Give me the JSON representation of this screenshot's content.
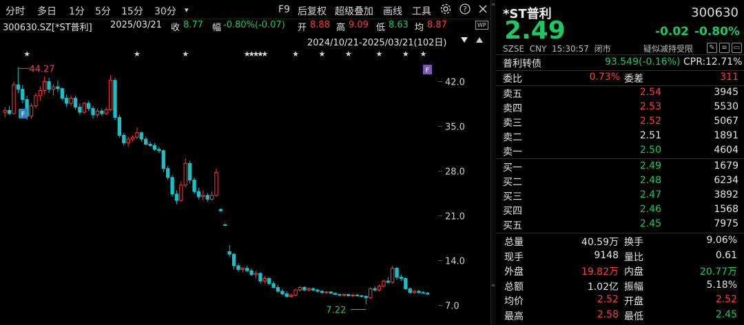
{
  "toolbar": {
    "items": [
      "分时",
      "多日",
      "1分",
      "5分",
      "15分",
      "30分",
      "▾",
      "F9",
      "后复权",
      "超级叠加",
      "画线",
      "工具"
    ],
    "gear_icon": "gear-icon",
    "help_icon": "question-icon",
    "close_icon": "close-icon"
  },
  "infobar": {
    "code": "300630.SZ[*ST普利]",
    "date": "2025/03/21",
    "close_label": "收",
    "close_value": "8.77",
    "change_label": "幅",
    "change_value": "-0.80%(-0.07)",
    "open_label": "开",
    "open_value": "8.88",
    "high_label": "高",
    "high_value": "9.09",
    "low_label": "低",
    "low_value": "8.63",
    "avg_label": "均",
    "avg_value": "8.87",
    "wp_icon": "WP"
  },
  "range": {
    "text": "2024/10/21-2025/03/21(102日)",
    "dropdown_icon": "triangle-down-icon"
  },
  "chart_data": {
    "type": "candlestick",
    "title": "",
    "xlabel": "",
    "ylabel": "",
    "ylim": [
      5.0,
      45.5
    ],
    "yticks": [
      "42.0",
      "35.0",
      "28.0",
      "21.0",
      "14.0",
      "7.0"
    ],
    "ytick_values": [
      42,
      35,
      28,
      21,
      14,
      7
    ],
    "max_label": "44.27",
    "min_label": "7.22",
    "f_markers": [
      "F",
      "F"
    ],
    "colors": {
      "up": "#ff3b3b",
      "down": "#18c0c8",
      "axis_text": "#cfcfcf",
      "grid": "#1f1f1f",
      "star": "#d8d8d8"
    },
    "candles": [
      [
        37.2,
        38.0,
        36.4,
        37.5
      ],
      [
        37.5,
        38.2,
        36.8,
        37.0
      ],
      [
        37.0,
        42.0,
        36.9,
        41.5
      ],
      [
        41.5,
        44.27,
        40.2,
        40.8
      ],
      [
        40.8,
        41.5,
        38.6,
        39.2
      ],
      [
        39.2,
        39.8,
        36.0,
        36.6
      ],
      [
        36.6,
        38.6,
        36.2,
        38.2
      ],
      [
        38.2,
        40.2,
        37.8,
        39.8
      ],
      [
        39.8,
        41.2,
        39.0,
        40.6
      ],
      [
        40.6,
        42.8,
        40.0,
        42.0
      ],
      [
        42.0,
        42.6,
        40.2,
        40.8
      ],
      [
        40.8,
        41.6,
        39.8,
        41.2
      ],
      [
        41.2,
        42.2,
        40.4,
        40.9
      ],
      [
        40.9,
        41.1,
        39.0,
        39.4
      ],
      [
        39.4,
        40.0,
        38.0,
        38.6
      ],
      [
        38.6,
        39.8,
        38.2,
        39.4
      ],
      [
        39.4,
        39.8,
        37.6,
        38.0
      ],
      [
        38.0,
        38.6,
        36.8,
        37.2
      ],
      [
        37.2,
        38.8,
        37.0,
        38.6
      ],
      [
        38.6,
        39.0,
        37.4,
        37.8
      ],
      [
        37.8,
        38.2,
        36.2,
        36.8
      ],
      [
        36.8,
        37.8,
        36.4,
        37.4
      ],
      [
        37.4,
        37.8,
        36.6,
        37.0
      ],
      [
        37.0,
        38.0,
        36.8,
        37.6
      ],
      [
        37.6,
        43.0,
        37.4,
        42.2
      ],
      [
        42.2,
        42.6,
        36.0,
        36.4
      ],
      [
        36.4,
        36.8,
        33.2,
        33.6
      ],
      [
        33.6,
        34.0,
        32.0,
        32.4
      ],
      [
        32.4,
        33.4,
        31.8,
        33.0
      ],
      [
        33.0,
        33.6,
        32.6,
        33.3
      ],
      [
        33.3,
        34.8,
        33.0,
        34.0
      ],
      [
        34.0,
        34.2,
        32.6,
        33.0
      ],
      [
        33.0,
        33.4,
        32.0,
        32.2
      ],
      [
        32.2,
        32.6,
        31.8,
        32.0
      ],
      [
        32.0,
        32.4,
        31.2,
        31.4
      ],
      [
        31.4,
        31.8,
        30.8,
        31.2
      ],
      [
        31.2,
        31.4,
        27.8,
        28.4
      ],
      [
        28.4,
        28.8,
        26.6,
        27.0
      ],
      [
        27.0,
        27.4,
        24.0,
        24.4
      ],
      [
        24.4,
        25.0,
        22.8,
        23.4
      ],
      [
        23.4,
        26.4,
        23.2,
        25.8
      ],
      [
        25.8,
        30.0,
        25.4,
        29.2
      ],
      [
        29.2,
        29.6,
        26.0,
        26.6
      ],
      [
        26.6,
        27.0,
        24.4,
        24.8
      ],
      [
        24.8,
        25.4,
        23.6,
        24.0
      ],
      [
        24.0,
        25.0,
        23.4,
        24.2
      ],
      [
        24.2,
        24.6,
        23.2,
        23.6
      ],
      [
        23.6,
        24.8,
        23.4,
        24.2
      ],
      [
        24.2,
        28.4,
        24.0,
        27.8
      ],
      [
        22.0,
        22.2,
        21.6,
        21.8
      ],
      [
        19.6,
        19.8,
        19.4,
        19.5
      ],
      [
        15.4,
        16.4,
        14.6,
        15.0
      ],
      [
        15.0,
        15.2,
        12.6,
        13.2
      ],
      [
        13.2,
        13.6,
        12.2,
        12.6
      ],
      [
        12.6,
        13.0,
        12.2,
        12.8
      ],
      [
        12.8,
        13.2,
        12.2,
        12.4
      ],
      [
        12.4,
        12.8,
        11.6,
        11.8
      ],
      [
        11.8,
        12.4,
        11.2,
        12.0
      ],
      [
        12.0,
        12.2,
        10.4,
        10.8
      ],
      [
        10.8,
        11.6,
        10.4,
        11.2
      ],
      [
        11.2,
        11.4,
        10.2,
        10.4
      ],
      [
        10.4,
        10.8,
        9.6,
        9.8
      ],
      [
        9.8,
        10.2,
        9.0,
        9.2
      ],
      [
        9.2,
        9.6,
        8.6,
        8.8
      ],
      [
        8.8,
        9.2,
        8.2,
        8.4
      ],
      [
        8.4,
        8.8,
        8.2,
        8.6
      ],
      [
        8.6,
        9.6,
        8.4,
        9.4
      ],
      [
        9.4,
        10.0,
        9.2,
        9.8
      ],
      [
        9.8,
        10.0,
        9.2,
        9.4
      ],
      [
        9.4,
        9.8,
        9.2,
        9.6
      ],
      [
        9.6,
        9.8,
        9.2,
        9.4
      ],
      [
        9.4,
        9.6,
        9.0,
        9.2
      ],
      [
        9.2,
        9.4,
        8.8,
        9.0
      ],
      [
        9.0,
        9.2,
        8.8,
        9.1
      ],
      [
        9.1,
        9.2,
        8.8,
        8.9
      ],
      [
        8.9,
        9.0,
        8.6,
        8.7
      ],
      [
        8.7,
        8.8,
        8.4,
        8.6
      ],
      [
        8.6,
        8.8,
        8.4,
        8.7
      ],
      [
        8.7,
        8.8,
        8.4,
        8.5
      ],
      [
        8.5,
        8.8,
        8.3,
        8.6
      ],
      [
        8.6,
        8.8,
        8.4,
        8.5
      ],
      [
        8.5,
        8.6,
        8.2,
        8.4
      ],
      [
        8.4,
        8.6,
        7.22,
        8.2
      ],
      [
        8.2,
        9.8,
        8.0,
        9.6
      ],
      [
        9.6,
        10.0,
        9.2,
        9.4
      ],
      [
        9.4,
        10.2,
        9.2,
        10.0
      ],
      [
        10.0,
        11.0,
        9.8,
        10.8
      ],
      [
        10.8,
        11.4,
        10.4,
        10.6
      ],
      [
        10.6,
        13.2,
        10.4,
        12.8
      ],
      [
        12.8,
        13.0,
        11.0,
        11.4
      ],
      [
        11.4,
        11.8,
        10.8,
        11.2
      ],
      [
        11.2,
        11.4,
        9.4,
        9.6
      ],
      [
        9.6,
        9.8,
        8.8,
        9.0
      ],
      [
        9.0,
        9.4,
        8.8,
        9.2
      ],
      [
        9.2,
        9.4,
        8.8,
        9.0
      ],
      [
        9.0,
        9.2,
        8.8,
        8.9
      ],
      [
        8.9,
        9.09,
        8.63,
        8.77
      ]
    ]
  },
  "quote": {
    "name": "*ST普利",
    "code": "300630",
    "price": "2.49",
    "change": "-0.02",
    "change_pct": "-0.80%",
    "exchange": "SZSE",
    "currency": "CNY",
    "time": "15:30:57",
    "status": "闭市",
    "alert": "疑似减持受限",
    "bond_name": "普利转债",
    "bond_value": "93.549(-0.16%)",
    "cpr_label": "CPR:",
    "cpr_value": "12.71%",
    "weibi_label": "委比",
    "weibi_value": "0.73%",
    "weicha_label": "委差",
    "weicha_value": "311",
    "asks": [
      {
        "label": "卖五",
        "price": "2.54",
        "vol": "3945",
        "color": "red"
      },
      {
        "label": "卖四",
        "price": "2.53",
        "vol": "5530",
        "color": "red"
      },
      {
        "label": "卖三",
        "price": "2.52",
        "vol": "5067",
        "color": "red"
      },
      {
        "label": "卖二",
        "price": "2.51",
        "vol": "1891",
        "color": "white"
      },
      {
        "label": "卖一",
        "price": "2.50",
        "vol": "4604",
        "color": "green"
      }
    ],
    "bids": [
      {
        "label": "买一",
        "price": "2.49",
        "vol": "1679",
        "color": "green"
      },
      {
        "label": "买二",
        "price": "2.48",
        "vol": "6234",
        "color": "green"
      },
      {
        "label": "买三",
        "price": "2.47",
        "vol": "3892",
        "color": "green"
      },
      {
        "label": "买四",
        "price": "2.46",
        "vol": "1568",
        "color": "green"
      },
      {
        "label": "买五",
        "price": "2.45",
        "vol": "7975",
        "color": "green"
      }
    ],
    "stats": [
      {
        "l1": "总量",
        "v1": "40.59万",
        "c1": "white",
        "l2": "换手",
        "v2": "9.06%",
        "c2": "white"
      },
      {
        "l1": "现手",
        "v1": "9148",
        "c1": "white",
        "l2": "量比",
        "v2": "0.61",
        "c2": "white"
      },
      {
        "l1": "外盘",
        "v1": "19.82万",
        "c1": "red",
        "l2": "内盘",
        "v2": "20.77万",
        "c2": "green"
      },
      {
        "l1": "总额",
        "v1": "1.02亿",
        "c1": "white",
        "l2": "振幅",
        "v2": "5.18%",
        "c2": "white"
      },
      {
        "l1": "均价",
        "v1": "2.52",
        "c1": "red",
        "l2": "开盘",
        "v2": "2.52",
        "c2": "red"
      },
      {
        "l1": "最高",
        "v1": "2.58",
        "c1": "red",
        "l2": "最低",
        "v2": "2.45",
        "c2": "green"
      }
    ]
  }
}
